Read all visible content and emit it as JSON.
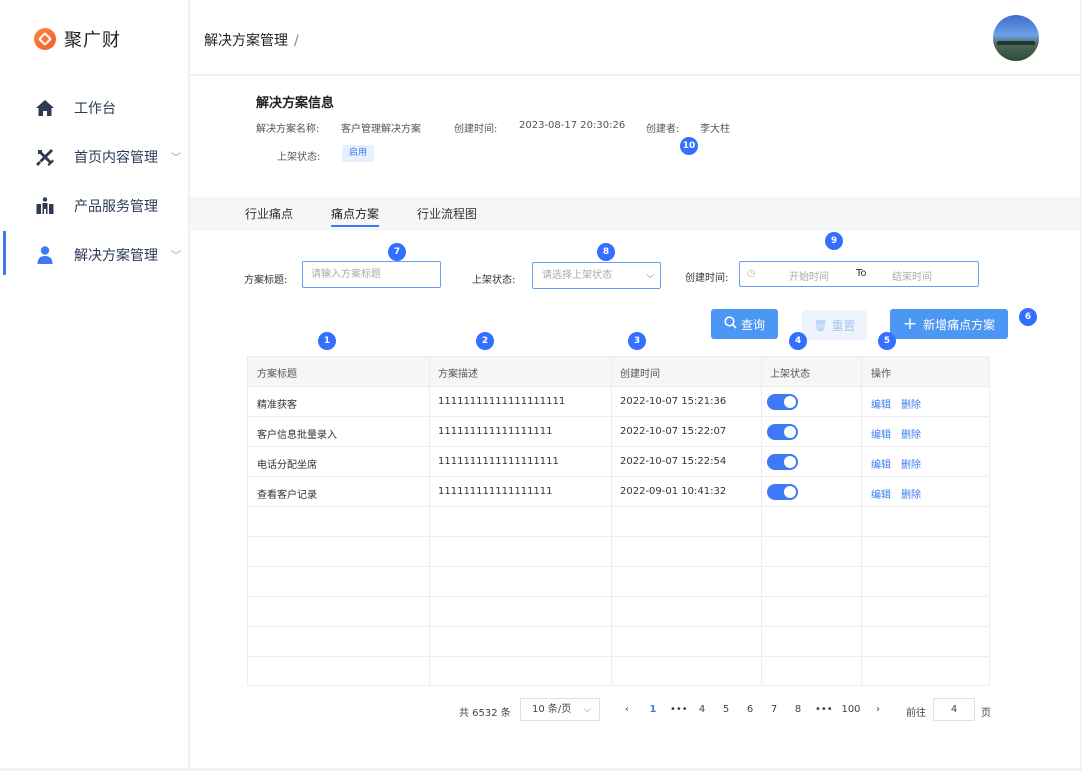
{
  "app": {
    "name": "聚广财"
  },
  "sidebar": {
    "items": [
      {
        "label": "工作台",
        "icon": "home-icon"
      },
      {
        "label": "首页内容管理",
        "icon": "tools-icon"
      },
      {
        "label": "产品服务管理",
        "icon": "building-icon"
      },
      {
        "label": "解决方案管理",
        "icon": "user-icon"
      }
    ]
  },
  "header": {
    "breadcrumb": "解决方案管理",
    "separator": "/"
  },
  "info": {
    "title": "解决方案信息",
    "name_label": "解决方案名称:",
    "name_value": "客户管理解决方案",
    "created_label": "创建时间:",
    "created_value": "2023-08-17  20:30:26",
    "creator_label": "创建者:",
    "creator_value": "李大柱",
    "status_label": "上架状态:",
    "status_value": "启用"
  },
  "tabs": [
    {
      "label": "行业痛点"
    },
    {
      "label": "痛点方案"
    },
    {
      "label": "行业流程图"
    }
  ],
  "filters": {
    "title_label": "方案标题:",
    "title_placeholder": "请输入方案标题",
    "status_label": "上架状态:",
    "status_placeholder": "请选择上架状态",
    "time_label": "创建时间:",
    "start_placeholder": "开始时间",
    "to_text": "To",
    "end_placeholder": "结束时间"
  },
  "buttons": {
    "query": "查询",
    "reset": "重置",
    "add": "新增痛点方案"
  },
  "markers": [
    "1",
    "2",
    "3",
    "4",
    "5",
    "6",
    "7",
    "8",
    "9",
    "10"
  ],
  "table": {
    "headers": [
      "方案标题",
      "方案描述",
      "创建时间",
      "上架状态",
      "操作"
    ],
    "rows": [
      {
        "title": "精准获客",
        "desc": "11111111111111111111",
        "time": "2022-10-07 15:21:36",
        "enabled": true
      },
      {
        "title": "客户信息批量录入",
        "desc": "111111111111111111",
        "time": "2022-10-07 15:22:07",
        "enabled": true
      },
      {
        "title": "电话分配坐席",
        "desc": "1111111111111111111",
        "time": "2022-10-07 15:22:54",
        "enabled": true
      },
      {
        "title": "查看客户记录",
        "desc": "111111111111111111",
        "time": "2022-09-01 10:41:32",
        "enabled": true
      }
    ],
    "edit_label": "编辑",
    "delete_label": "删除"
  },
  "pagination": {
    "total_text": "共 6532 条",
    "page_size": "10 条/页",
    "pages": [
      "1",
      "•••",
      "4",
      "5",
      "6",
      "7",
      "8",
      "•••",
      "100"
    ],
    "current_page": 1,
    "goto_label": "前往",
    "goto_value": "4",
    "page_suffix": "页"
  }
}
